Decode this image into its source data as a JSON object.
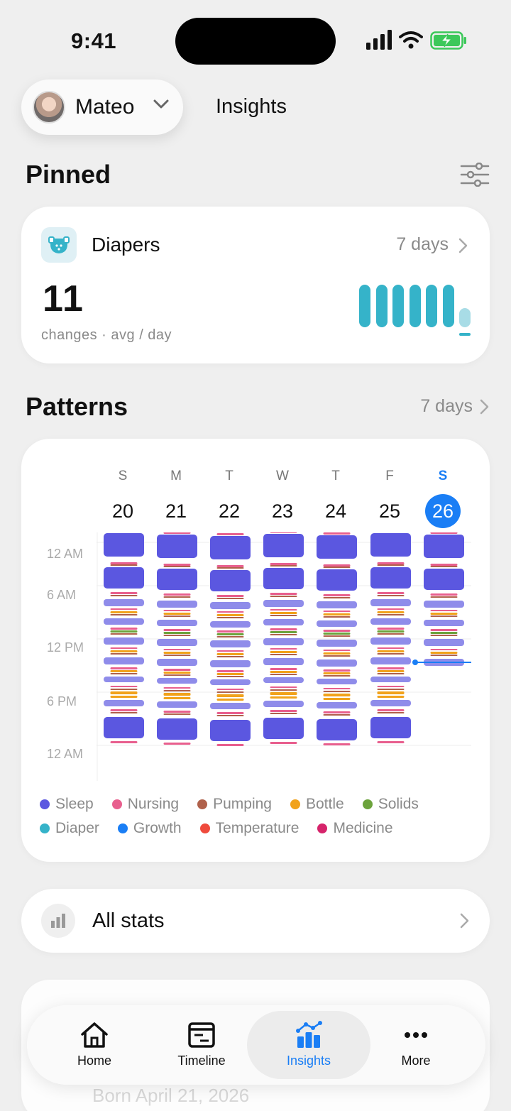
{
  "status_bar": {
    "time": "9:41"
  },
  "header": {
    "profile_name": "Mateo",
    "title": "Insights"
  },
  "pinned": {
    "section_title": "Pinned",
    "card": {
      "icon": "diaper-icon",
      "title": "Diapers",
      "range": "7 days",
      "value": "11",
      "sub_label": "changes · avg / day",
      "bars": [
        1,
        1,
        1,
        1,
        1,
        1,
        0.45
      ],
      "colors": {
        "full": "#35b3c9",
        "partial": "#a8dce6"
      }
    }
  },
  "patterns": {
    "section_title": "Patterns",
    "range": "7 days",
    "days": [
      {
        "letter": "S",
        "num": "20",
        "today": false
      },
      {
        "letter": "M",
        "num": "21",
        "today": false
      },
      {
        "letter": "T",
        "num": "22",
        "today": false
      },
      {
        "letter": "W",
        "num": "23",
        "today": false
      },
      {
        "letter": "T",
        "num": "24",
        "today": false
      },
      {
        "letter": "F",
        "num": "25",
        "today": false
      },
      {
        "letter": "S",
        "num": "26",
        "today": true
      }
    ],
    "time_labels": [
      "12 AM",
      "6 AM",
      "12 PM",
      "6 PM",
      "12 AM"
    ],
    "legend": [
      {
        "label": "Sleep",
        "color": "#5b57e0"
      },
      {
        "label": "Nursing",
        "color": "#e85f8e"
      },
      {
        "label": "Pumping",
        "color": "#b0614b"
      },
      {
        "label": "Bottle",
        "color": "#f1a21b"
      },
      {
        "label": "Solids",
        "color": "#6ca33c"
      },
      {
        "label": "Diaper",
        "color": "#35b3c9"
      },
      {
        "label": "Growth",
        "color": "#1a7ef5"
      },
      {
        "label": "Temperature",
        "color": "#ef4a3c"
      },
      {
        "label": "Medicine",
        "color": "#d6246b"
      }
    ]
  },
  "all_stats": {
    "label": "All stats"
  },
  "faded_card": {
    "line2": "Born April 21, 2026"
  },
  "tabs": [
    {
      "label": "Home",
      "icon": "home-icon",
      "active": false
    },
    {
      "label": "Timeline",
      "icon": "timeline-icon",
      "active": false
    },
    {
      "label": "Insights",
      "icon": "insights-icon",
      "active": true
    },
    {
      "label": "More",
      "icon": "more-icon",
      "active": false
    }
  ]
}
